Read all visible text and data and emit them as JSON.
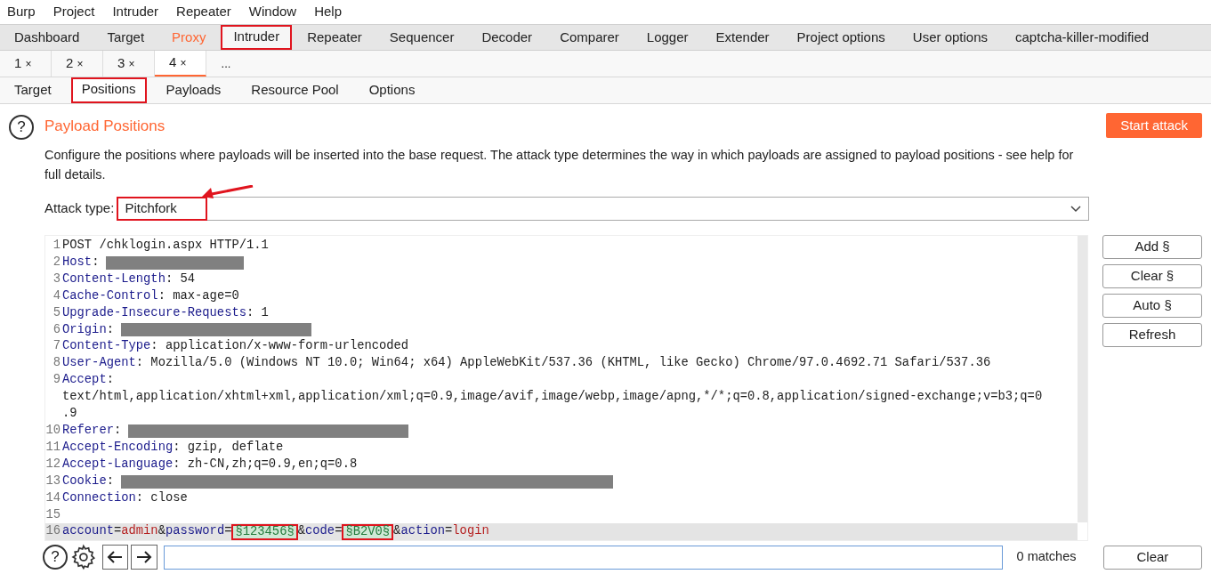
{
  "menu": [
    "Burp",
    "Project",
    "Intruder",
    "Repeater",
    "Window",
    "Help"
  ],
  "main_tabs": [
    {
      "label": "Dashboard",
      "selected": false,
      "highlighted": false,
      "annotated": false
    },
    {
      "label": "Target",
      "selected": false,
      "highlighted": false,
      "annotated": false
    },
    {
      "label": "Proxy",
      "selected": false,
      "highlighted": true,
      "annotated": false
    },
    {
      "label": "Intruder",
      "selected": true,
      "highlighted": false,
      "annotated": true
    },
    {
      "label": "Repeater",
      "selected": false,
      "highlighted": false,
      "annotated": false
    },
    {
      "label": "Sequencer",
      "selected": false,
      "highlighted": false,
      "annotated": false
    },
    {
      "label": "Decoder",
      "selected": false,
      "highlighted": false,
      "annotated": false
    },
    {
      "label": "Comparer",
      "selected": false,
      "highlighted": false,
      "annotated": false
    },
    {
      "label": "Logger",
      "selected": false,
      "highlighted": false,
      "annotated": false
    },
    {
      "label": "Extender",
      "selected": false,
      "highlighted": false,
      "annotated": false
    },
    {
      "label": "Project options",
      "selected": false,
      "highlighted": false,
      "annotated": false
    },
    {
      "label": "User options",
      "selected": false,
      "highlighted": false,
      "annotated": false
    },
    {
      "label": "captcha-killer-modified",
      "selected": false,
      "highlighted": false,
      "annotated": false
    }
  ],
  "attack_tabs": [
    {
      "label": "1",
      "close": "×",
      "selected": false
    },
    {
      "label": "2",
      "close": "×",
      "selected": false
    },
    {
      "label": "3",
      "close": "×",
      "selected": false
    },
    {
      "label": "4",
      "close": "×",
      "selected": true
    }
  ],
  "attack_tabs_more": "...",
  "sub_tabs": [
    {
      "label": "Target",
      "selected": false,
      "annotated": false
    },
    {
      "label": "Positions",
      "selected": true,
      "annotated": true
    },
    {
      "label": "Payloads",
      "selected": false,
      "annotated": false
    },
    {
      "label": "Resource Pool",
      "selected": false,
      "annotated": false
    },
    {
      "label": "Options",
      "selected": false,
      "annotated": false
    }
  ],
  "section": {
    "help_icon": "?",
    "title": "Payload Positions",
    "description": "Configure the positions where payloads will be inserted into the base request. The attack type determines the way in which payloads are assigned to payload positions - see help for full details.",
    "start_button": "Start attack"
  },
  "attack_type": {
    "label": "Attack type:",
    "value": "Pitchfork",
    "annotated": true
  },
  "request_lines": [
    {
      "number": "1",
      "selected": false,
      "segments": [
        {
          "kind": "plain",
          "text": "POST /chklogin.aspx HTTP/1.1"
        }
      ]
    },
    {
      "number": "2",
      "selected": false,
      "segments": [
        {
          "kind": "name",
          "text": "Host"
        },
        {
          "kind": "plain",
          "text": ":"
        },
        {
          "kind": "redacted"
        }
      ]
    },
    {
      "number": "3",
      "selected": false,
      "segments": [
        {
          "kind": "name",
          "text": "Content-Length"
        },
        {
          "kind": "plain",
          "text": ": 54"
        }
      ]
    },
    {
      "number": "4",
      "selected": false,
      "segments": [
        {
          "kind": "name",
          "text": "Cache-Control"
        },
        {
          "kind": "plain",
          "text": ": max-age=0"
        }
      ]
    },
    {
      "number": "5",
      "selected": false,
      "segments": [
        {
          "kind": "name",
          "text": "Upgrade-Insecure-Requests"
        },
        {
          "kind": "plain",
          "text": ": 1"
        }
      ]
    },
    {
      "number": "6",
      "selected": false,
      "segments": [
        {
          "kind": "name",
          "text": "Origin"
        },
        {
          "kind": "plain",
          "text": ":"
        },
        {
          "kind": "redacted"
        }
      ]
    },
    {
      "number": "7",
      "selected": false,
      "segments": [
        {
          "kind": "name",
          "text": "Content-Type"
        },
        {
          "kind": "plain",
          "text": ": application/x-www-form-urlencoded"
        }
      ]
    },
    {
      "number": "8",
      "selected": false,
      "segments": [
        {
          "kind": "name",
          "text": "User-Agent"
        },
        {
          "kind": "plain",
          "text": ": Mozilla/5.0 (Windows NT 10.0; Win64; x64) AppleWebKit/537.36 (KHTML, like Gecko) Chrome/97.0.4692.71 Safari/537.36"
        }
      ]
    },
    {
      "number": "9",
      "selected": false,
      "segments": [
        {
          "kind": "name",
          "text": "Accept"
        },
        {
          "kind": "plain",
          "text": ":"
        }
      ]
    },
    {
      "selected": false,
      "segments": [
        {
          "kind": "plain",
          "text": "text/html,application/xhtml+xml,application/xml;q=0.9,image/avif,image/webp,image/apng,*/*;q=0.8,application/signed-exchange;v=b3;q=0"
        }
      ]
    },
    {
      "selected": false,
      "segments": [
        {
          "kind": "plain",
          "text": ".9"
        }
      ]
    },
    {
      "number": "10",
      "selected": false,
      "segments": [
        {
          "kind": "name",
          "text": "Referer"
        },
        {
          "kind": "plain",
          "text": ":"
        },
        {
          "kind": "redacted"
        }
      ]
    },
    {
      "number": "11",
      "selected": false,
      "segments": [
        {
          "kind": "name",
          "text": "Accept-Encoding"
        },
        {
          "kind": "plain",
          "text": ": gzip, deflate"
        }
      ]
    },
    {
      "number": "12",
      "selected": false,
      "segments": [
        {
          "kind": "name",
          "text": "Accept-Language"
        },
        {
          "kind": "plain",
          "text": ": zh-CN,zh;q=0.9,en;q=0.8"
        }
      ]
    },
    {
      "number": "13",
      "selected": false,
      "segments": [
        {
          "kind": "name",
          "text": "Cookie"
        },
        {
          "kind": "plain",
          "text": ":"
        },
        {
          "kind": "redacted"
        }
      ]
    },
    {
      "number": "14",
      "selected": false,
      "segments": [
        {
          "kind": "name",
          "text": "Connection"
        },
        {
          "kind": "plain",
          "text": ": close"
        }
      ]
    },
    {
      "number": "15",
      "selected": false
    },
    {
      "number": "16",
      "selected": true,
      "segments": [
        {
          "kind": "name",
          "text": "account"
        },
        {
          "kind": "plain",
          "text": "="
        },
        {
          "kind": "value",
          "text": "admin"
        },
        {
          "kind": "plain",
          "text": "&"
        },
        {
          "kind": "name",
          "text": "password"
        },
        {
          "kind": "plain",
          "text": "="
        },
        {
          "kind": "payload",
          "text": "§123456§",
          "annotated": true
        },
        {
          "kind": "plain",
          "text": "&"
        },
        {
          "kind": "name",
          "text": "code"
        },
        {
          "kind": "plain",
          "text": "="
        },
        {
          "kind": "payload",
          "text": "§B2V0§",
          "annotated": true
        },
        {
          "kind": "plain",
          "text": "&"
        },
        {
          "kind": "name",
          "text": "action"
        },
        {
          "kind": "plain",
          "text": "="
        },
        {
          "kind": "value",
          "text": "login"
        }
      ]
    }
  ],
  "side_buttons": [
    "Add §",
    "Clear §",
    "Auto §",
    "Refresh"
  ],
  "search_bar": {
    "help_icon": "?",
    "matches": "0 matches",
    "clear_button": "Clear"
  }
}
